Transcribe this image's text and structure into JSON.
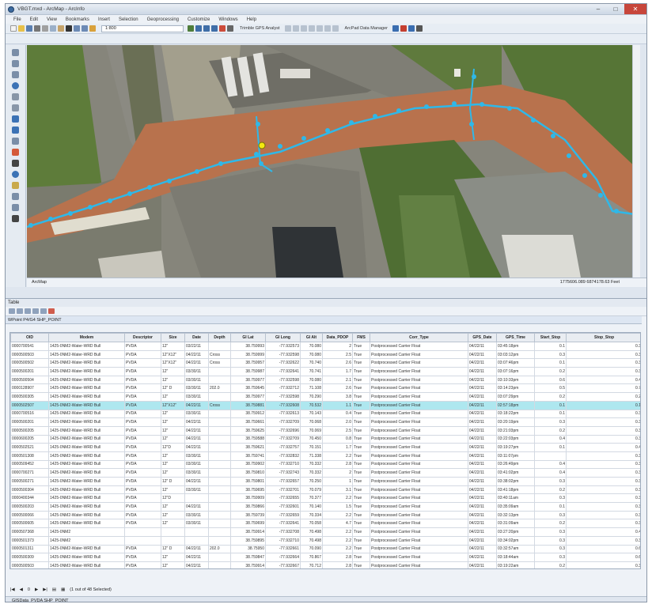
{
  "window": {
    "title": "VBGT.mxd - ArcMap - ArcInfo",
    "minimize": "–",
    "maximize": "□",
    "close": "✕"
  },
  "menu": [
    "File",
    "Edit",
    "View",
    "Bookmarks",
    "Insert",
    "Selection",
    "Geoprocessing",
    "Customize",
    "Windows",
    "Help"
  ],
  "toolbar": {
    "scale": "1:800",
    "gps": "Trimble GPS Analyst",
    "datamanager": "ArcPad Data Manager"
  },
  "mapstatus": {
    "left": "ArcMap",
    "coords": "1775606.089 6874178.63 Feet"
  },
  "table": {
    "title": "Table",
    "layer_tab": "WPoint P4/G4 SHP_POINT",
    "columns": [
      "OID",
      "Modem",
      "Descriptor",
      "Size",
      "Date",
      "Depth",
      "GI Lat",
      "GI Long",
      "GI Alt",
      "Data_PDOP",
      "FMS",
      "Corr_Type",
      "GPS_Date",
      "GPS_Time",
      "Start_Stop",
      "Stop_Stop"
    ],
    "rows": [
      [
        "0000700541",
        "1425-0NM2-Water-WRD Bull",
        "PVDA",
        "12\"",
        "03/22/11",
        "",
        "38.759993",
        "-77.932573",
        "70.080",
        "2",
        "True",
        "Postprocessed Carrier Float",
        "04/22/11",
        "03:45:18pm",
        "0.1",
        "0.3"
      ],
      [
        "0000500503",
        "1425-0NM2-Water-WRD Bull",
        "PVDA",
        "12\"X12\"",
        "04/22/11",
        "Cross",
        "38.759999",
        "-77.932598",
        "70.080",
        "2.5",
        "True",
        "Postprocessed Carrier Float",
        "04/22/11",
        "03:03:12pm",
        "0.3",
        "0.3"
      ],
      [
        "0000500502",
        "1425-0NM2-Water-WRD Bull",
        "PVDA",
        "12\"X12\"",
        "04/22/11",
        "Cross",
        "38.759957",
        "-77.932622",
        "70.740",
        "2.6",
        "True",
        "Postprocessed Carrier Float",
        "04/22/11",
        "03:07:46pm",
        "0.1",
        "0.3"
      ],
      [
        "0000500201",
        "1425-0NM2-Water-WRD Bull",
        "PVDA",
        "12\"",
        "03/30/11",
        "",
        "38.759987",
        "-77.932641",
        "70.741",
        "1.7",
        "True",
        "Postprocessed Carrier Float",
        "04/22/11",
        "03:07:16pm",
        "0.2",
        "0.3"
      ],
      [
        "0000500504",
        "1425-0NM2-Water-WRD Bull",
        "PVDA",
        "12\"",
        "03/30/11",
        "",
        "38.759977",
        "-77.932598",
        "70.080",
        "2.1",
        "True",
        "Postprocessed Carrier Float",
        "04/22/11",
        "03:10:33pm",
        "0.6",
        "0.4"
      ],
      [
        "0000128907",
        "1425-0NM2-Water-WRD Bull",
        "PVDA",
        "12\" D",
        "03/30/11",
        "202.0",
        "38.759645",
        "-77.932712",
        "71.108",
        "2.6",
        "True",
        "Postprocessed Carrier Float",
        "04/22/11",
        "03:14:23pm",
        "0.5",
        "0.7"
      ],
      [
        "0000500305",
        "1425-0NM2-Water-WRD Bull",
        "PVDA",
        "12\"",
        "03/30/11",
        "",
        "38.759977",
        "-77.932598",
        "70.290",
        "3.8",
        "True",
        "Postprocessed Carrier Float",
        "04/22/11",
        "03:07:29pm",
        "0.2",
        "0.2"
      ],
      [
        "0000502507",
        "1425-0NM2-Water-WRD Bull",
        "PVDA",
        "12\"X12\"",
        "04/22/11",
        "Cross",
        "38.759881",
        "-77.932608",
        "70.532",
        "1.1",
        "True",
        "Postprocessed Carrier Float",
        "04/22/11",
        "02:57:18pm",
        "0.1",
        "0.1"
      ],
      [
        "0000700516",
        "1425-0NM2-Water-WRD Bull",
        "PVDA",
        "12\"",
        "03/30/11",
        "",
        "38.759912",
        "-77.932613",
        "70.143",
        "0.4",
        "True",
        "Postprocessed Carrier Float",
        "04/22/11",
        "03:18:22pm",
        "0.1",
        "0.3"
      ],
      [
        "0000500201",
        "1425-0NM2-Water-WRD Bull",
        "PVDA",
        "12\"",
        "04/22/11",
        "",
        "38.759661",
        "-77.932709",
        "70.068",
        "2.0",
        "True",
        "Postprocessed Carrier Float",
        "04/22/11",
        "03:20:19pm",
        "0.3",
        "0.3"
      ],
      [
        "0000500205",
        "1425-0NM2-Water-WRD Bull",
        "PVDA",
        "12\"",
        "04/22/11",
        "",
        "38.759625",
        "-77.932696",
        "70.069",
        "2.5",
        "True",
        "Postprocessed Carrier Float",
        "04/22/11",
        "03:21:03pm",
        "0.2",
        "0.3"
      ],
      [
        "0000600205",
        "1425-0NM2-Water-WRD Bull",
        "PVDA",
        "12\"",
        "04/22/11",
        "",
        "38.759588",
        "-77.932709",
        "70.450",
        "0.8",
        "True",
        "Postprocessed Carrier Float",
        "04/22/11",
        "03:22:03pm",
        "0.4",
        "0.3"
      ],
      [
        "0000502521",
        "1425-0NM2-Water-WRD Bull",
        "PVDA",
        "12\"D",
        "04/22/11",
        "",
        "38.759621",
        "-77.932757",
        "70.151",
        "1.7",
        "True",
        "Postprocessed Carrier Float",
        "04/22/11",
        "03:19:27pm",
        "0.1",
        "0.4"
      ],
      [
        "0000501308",
        "1425-0NM2-Water-WRD Bull",
        "PVDA",
        "12\"",
        "03/30/11",
        "",
        "38.759741",
        "-77.932832",
        "71.338",
        "2.2",
        "True",
        "Postprocessed Carrier Float",
        "04/22/11",
        "03:11:07pm",
        "",
        "0.3"
      ],
      [
        "0000509452",
        "1425-0NM2-Water-WRD Bull",
        "PVDA",
        "12\"",
        "03/30/11",
        "",
        "38.759902",
        "-77.932710",
        "70.332",
        "2.8",
        "True",
        "Postprocessed Carrier Float",
        "04/22/11",
        "03:26:49pm",
        "0.4",
        "0.3"
      ],
      [
        "0000700271",
        "1425-0NM2-Water-WRD Bull",
        "PVDA",
        "12\"",
        "03/30/11",
        "",
        "38.759810",
        "-77.932743",
        "70.332",
        "2",
        "True",
        "Postprocessed Carrier Float",
        "04/22/11",
        "03:41:02pm",
        "0.4",
        "0.3"
      ],
      [
        "0000500271",
        "1425-0NM2-Water-WRD Bull",
        "PVDA",
        "12\" D",
        "04/22/11",
        "",
        "38.759801",
        "-77.932657",
        "70.250",
        "1",
        "True",
        "Postprocessed Carrier Float",
        "04/22/11",
        "03:38:02pm",
        "0.3",
        "0.3"
      ],
      [
        "0000500304",
        "1425-0NM2-Water-WRD Bull",
        "PVDA",
        "12\"",
        "03/30/11",
        "",
        "38.759695",
        "-77.932701",
        "70.079",
        "3.1",
        "True",
        "Postprocessed Carrier Float",
        "04/22/11",
        "03:41:18pm",
        "0.2",
        "0.3"
      ],
      [
        "0000400344",
        "1425-0NM2-Water-WRD Bull",
        "PVDA",
        "12\"D",
        "",
        "",
        "38.759909",
        "-77.932655",
        "70.377",
        "2.2",
        "True",
        "Postprocessed Carrier Float",
        "04/22/11",
        "03:40:11am",
        "0.3",
        "0.3"
      ],
      [
        "0000500203",
        "1425-0NM2-Water-WRD Bull",
        "PVDA",
        "12\"",
        "04/22/11",
        "",
        "38.759866",
        "-77.932601",
        "70.140",
        "1.5",
        "True",
        "Postprocessed Carrier Float",
        "04/22/11",
        "03:35:09am",
        "0.1",
        "0.3"
      ],
      [
        "0000500066",
        "1425-0NM2-Water-WRD Bull",
        "PVDA",
        "12\"",
        "03/30/11",
        "",
        "38.759739",
        "-77.932659",
        "70.334",
        "2.2",
        "True",
        "Postprocessed Carrier Float",
        "04/22/11",
        "03:32:13pm",
        "0.3",
        "0.3"
      ],
      [
        "0000500605",
        "1425-0NM2-Water-WRD Bull",
        "PVDA",
        "12\"",
        "03/30/11",
        "",
        "38.759699",
        "-77.932641",
        "70.058",
        "4.7",
        "True",
        "Postprocessed Carrier Float",
        "04/22/11",
        "03:31:09am",
        "0.2",
        "0.3"
      ],
      [
        "0000507368",
        "1425-0NM2",
        "",
        "",
        "",
        "",
        "38.759914",
        "-77.932708",
        "70.498",
        "2.2",
        "True",
        "Postprocessed Carrier Float",
        "04/22/11",
        "03:27:20pm",
        "0.3",
        "0.4"
      ],
      [
        "0000501373",
        "1425-0NM2",
        "",
        "",
        "",
        "",
        "38.759895",
        "-77.932710",
        "70.498",
        "2.2",
        "True",
        "Postprocessed Carrier Float",
        "04/22/11",
        "03:34:02pm",
        "0.3",
        "0.3"
      ],
      [
        "0000501311",
        "1425-0NM2-Water-WRD Bull",
        "PVDA",
        "12\" D",
        "04/22/11",
        "202.0",
        "38.75950",
        "-77.932661",
        "70.090",
        "2.2",
        "True",
        "Postprocessed Carrier Float",
        "04/22/11",
        "03:32:57am",
        "0.3",
        "0.6"
      ],
      [
        "0000500309",
        "1425-0NM2-Water-WRD Bull",
        "PVDA",
        "12\"",
        "04/22/11",
        "",
        "38.759847",
        "-77.932664",
        "70.867",
        "2.8",
        "True",
        "Postprocessed Carrier Float",
        "04/22/11",
        "03:18:44am",
        "0.3",
        "0.6"
      ],
      [
        "0000500503",
        "1425-0NM2-Water-WRD Bull",
        "PVDA",
        "12\"",
        "04/22/11",
        "",
        "38.759914",
        "-77.932667",
        "70.712",
        "2.8",
        "True",
        "Postprocessed Carrier Float",
        "04/22/11",
        "03:19:22am",
        "0.2",
        "0.3"
      ],
      [
        "0000500201",
        "1425-0NM2-Water-WRD Bull",
        "PVDA",
        "12\"",
        "03/30/11",
        "",
        "38.759779",
        "-77.932707",
        "70.02",
        "2.8",
        "True",
        "Postprocessed Carrier Float",
        "04/22/11",
        "03:53:18am",
        "0.3",
        "0.6"
      ],
      [
        "0000500503",
        "1425-0NM2-Water-WRD Bull",
        "PVDA",
        "12\" D",
        "03/30/11",
        "202.0",
        "38.759677",
        "-77.932662",
        "70.008",
        "2.8",
        "True",
        "Postprocessed Carrier Float",
        "04/22/11",
        "03:56:18am",
        "0.3",
        "0.6"
      ]
    ],
    "footer": {
      "record": "0",
      "status": "(1 out of 48 Selected)"
    },
    "bottom_tab": "GISData_PVDA SHP_POINT"
  }
}
